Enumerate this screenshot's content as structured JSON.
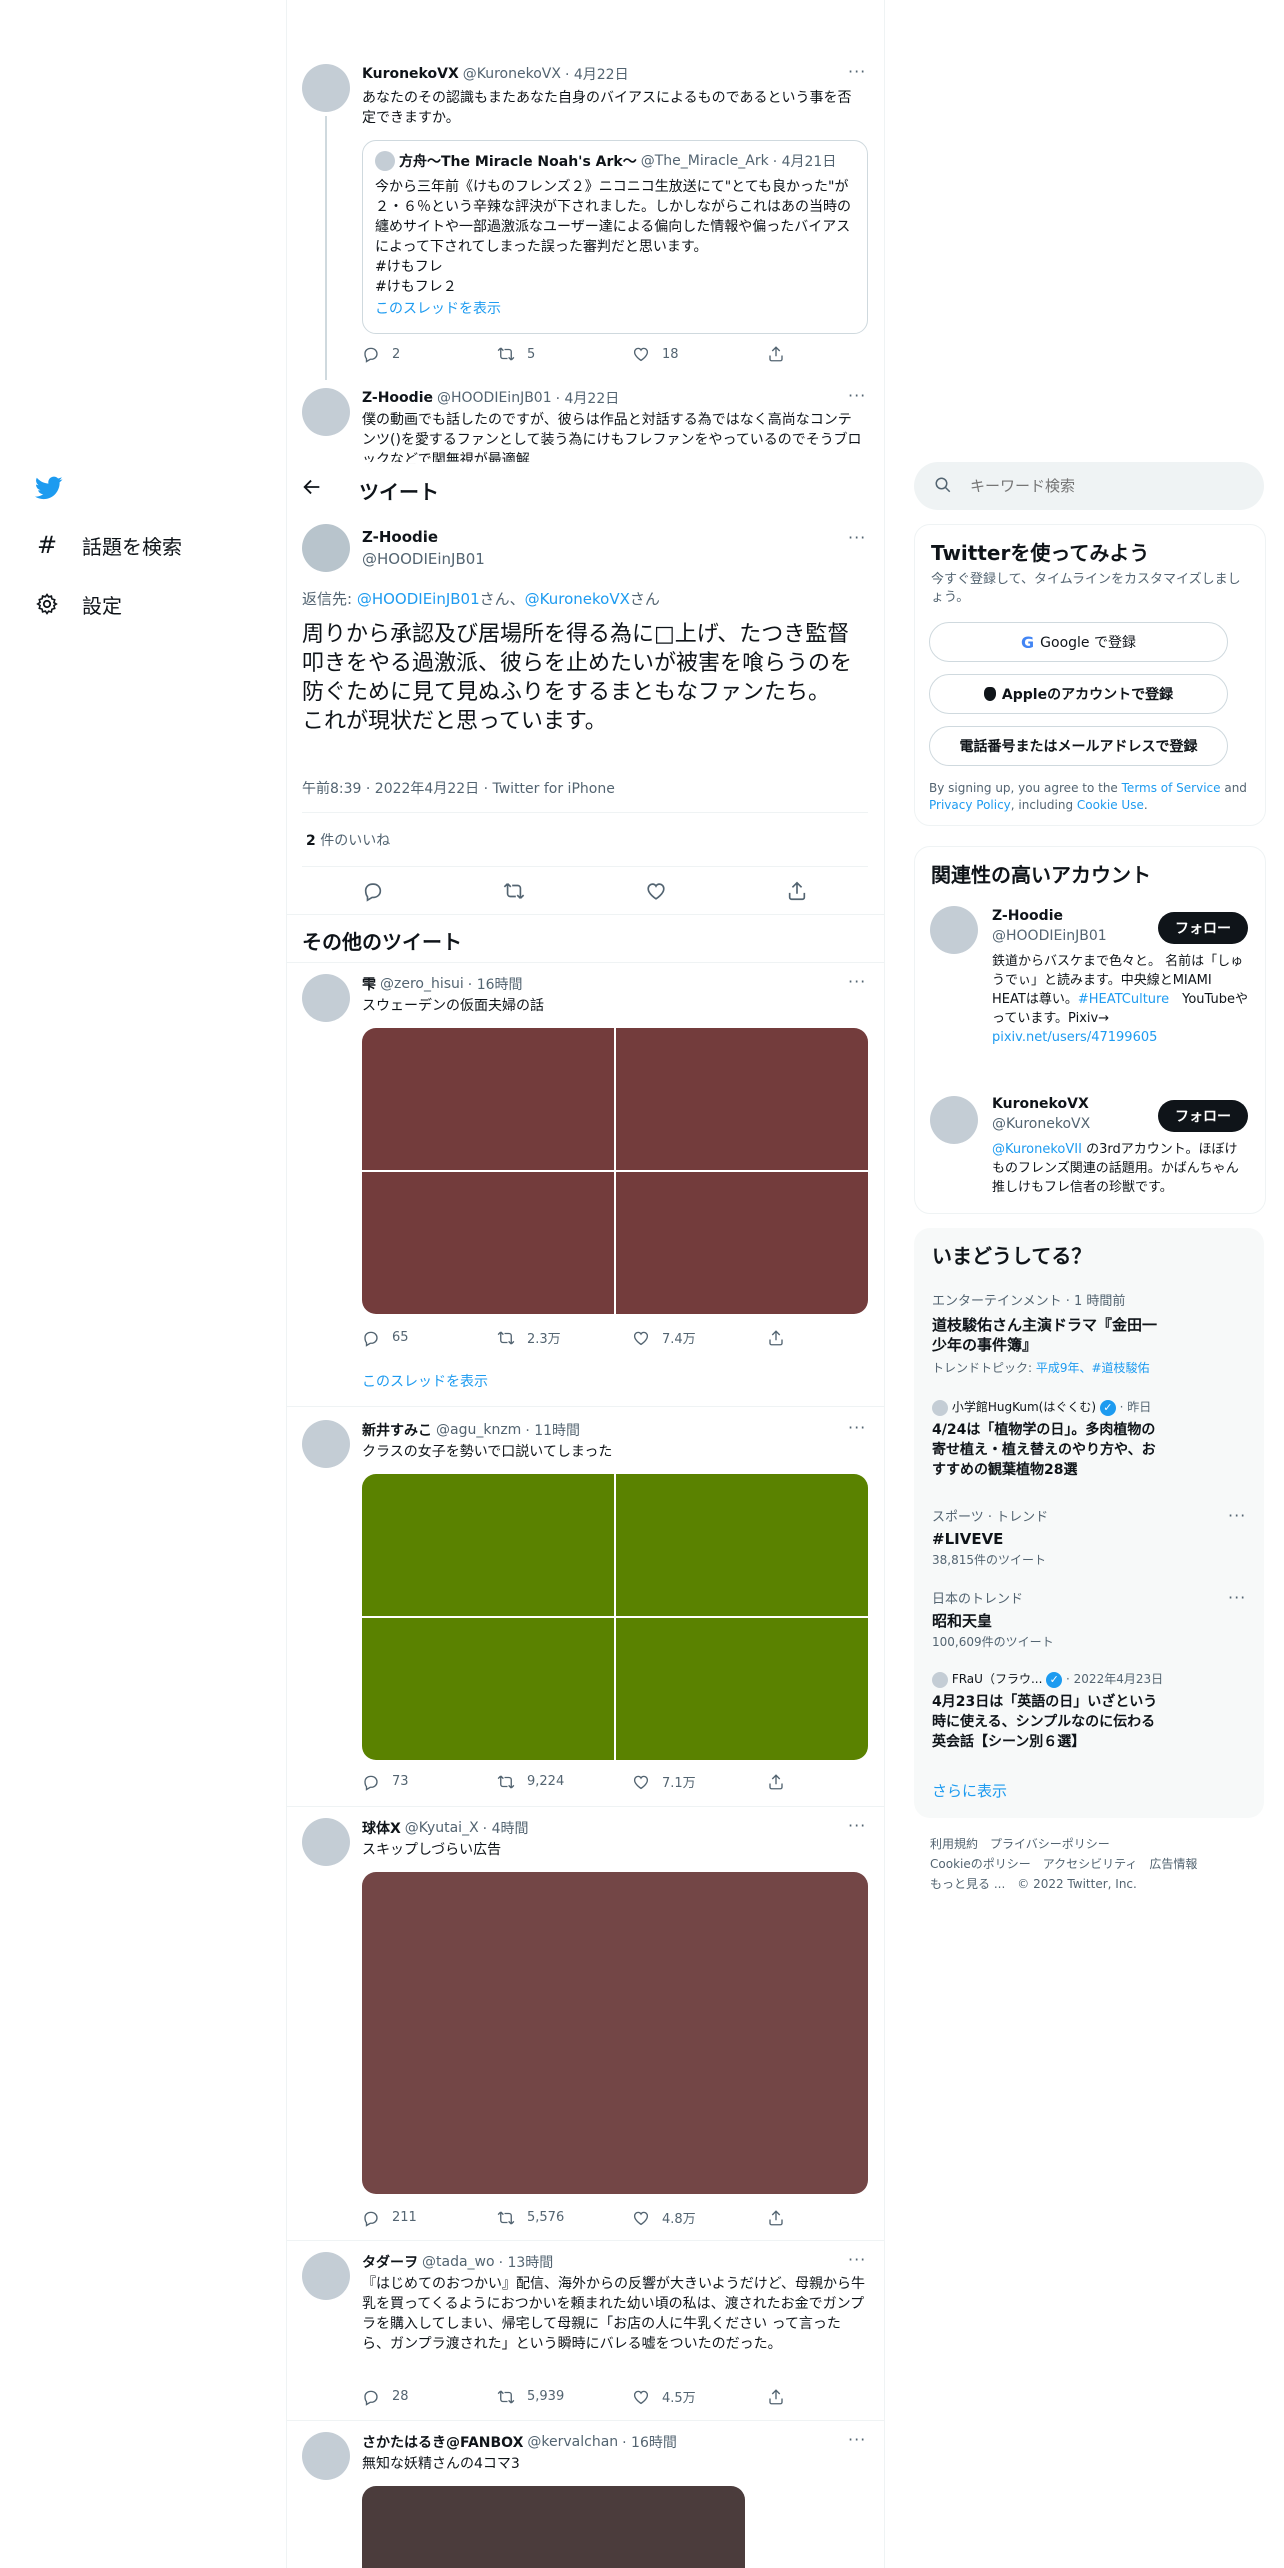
{
  "nav": {
    "explore_label": "話題を検索",
    "settings_label": "設定"
  },
  "header": {
    "title": "ツイート"
  },
  "context_tweets": [
    {
      "name": "KuronekoVX",
      "handle": "@KuronekoVX",
      "time": "· 4月22日",
      "text": "あなたのその認識もまたあなた自身のバイアスによるものであるという事を否定できますか。",
      "quote": {
        "name": "方舟～The Miracle Noah's Ark～",
        "handle": "@The_Miracle_Ark",
        "time": "· 4月21日",
        "lines": [
          "今から三年前《けものフレンズ２》ニコニコ生放送にて\"とても良かった\"が２・６％という辛辣な評決が下されました。しかしながらこれはあの当時の纏めサイトや一部過激派なユーザー達による偏向した情報や偏ったバイアスによって下されてしまった誤った審判だと思います。",
          "#けもフレ",
          "#けもフレ２"
        ],
        "thread_link": "このスレッドを表示"
      },
      "replies": "2",
      "retweets": "5",
      "likes": "18"
    },
    {
      "name": "Z-Hoodie",
      "handle": "@HOODIEinJB01",
      "time": "· 4月22日",
      "text": "僕の動画でも話したのですが、彼らは作品と対話する為ではなく高尚なコンテンツ()を愛するファンとして装う為にけもフレファンをやっているのでそうブロックなどで関無視が最適解"
    }
  ],
  "main_tweet": {
    "name": "Z-Hoodie",
    "handle": "@HOODIEinJB01",
    "reply_prefix": "返信先: ",
    "reply_to_1": "@HOODIEinJB01",
    "reply_san_1": "さん、",
    "reply_to_2": "@KuronekoVX",
    "reply_san_2": "さん",
    "text_1": "周りから承認及び居場所を得る為に□上げ、たつき監督叩きをやる過激派、彼らを止めたいが被害を喰らうのを防ぐために見て見ぬふりをするまともなファンたち。",
    "text_2": "これが現状だと思っています。",
    "meta": "午前8:39 · 2022年4月22日 · Twitter for iPhone",
    "likes_count": "2",
    "likes_label": " 件のいいね"
  },
  "more_tweets": {
    "heading": "その他のツイート",
    "items": [
      {
        "name": "雫",
        "handle": "@zero_hisui",
        "time": "· 16時間",
        "text": "スウェーデンの仮面夫婦の話",
        "image_color": "#733c3c",
        "replies": "65",
        "retweets": "2.3万",
        "likes": "7.4万",
        "thread_link": "このスレッドを表示"
      },
      {
        "name": "新井すみこ",
        "handle": "@agu_knzm",
        "time": "· 11時間",
        "text": "クラスの女子を勢いで口説いてしまった",
        "image_color": "#5a8200",
        "replies": "73",
        "retweets": "9,224",
        "likes": "7.1万"
      },
      {
        "name": "球体X",
        "handle": "@Kyutai_X",
        "time": "· 4時間",
        "text": "スキップしづらい広告",
        "image_color": "#734646",
        "replies": "211",
        "retweets": "5,576",
        "likes": "4.8万"
      },
      {
        "name": "タダーヲ",
        "handle": "@tada_wo",
        "time": "· 13時間",
        "text": "『はじめてのおつかい』配信、海外からの反響が大きいようだけど、母親から牛乳を買ってくるようにおつかいを頼まれた幼い頃の私は、渡されたお金でガンプラを購入してしまい、帰宅して母親に「お店の人に牛乳ください って言ったら、ガンプラ渡された」という瞬時にバレる嘘をついたのだった。",
        "replies": "28",
        "retweets": "5,939",
        "likes": "4.5万"
      },
      {
        "name": "さかたはるき@FANBOX",
        "handle": "@kervalchan",
        "time": "· 16時間",
        "text": "無知な妖精さんの4コマ3",
        "image_color": "#4b3c3c"
      }
    ]
  },
  "search": {
    "placeholder": "キーワード検索"
  },
  "signup": {
    "title": "Twitterを使ってみよう",
    "subtitle": "今すぐ登録して、タイムラインをカスタマイズしましょう。",
    "google": "Google で登録",
    "apple": "Appleのアカウントで登録",
    "phone": "電話番号またはメールアドレスで登録",
    "terms_1": "By signing up, you agree to the ",
    "terms_link": "Terms of Service",
    "terms_2": " and ",
    "privacy_link": "Privacy Policy",
    "terms_3": ", including ",
    "cookie_link": "Cookie Use",
    "terms_4": "."
  },
  "relevant": {
    "title": "関連性の高いアカウント",
    "follow_label": "フォロー",
    "accounts": [
      {
        "name": "Z-Hoodie",
        "handle": "@HOODIEinJB01",
        "bio_1": "鉄道からバスケまで色々と。 名前は「しゅうでぃ」と読みます。中央線とMIAMI HEATは尊い。",
        "bio_link_1": "#HEATCulture",
        "bio_2": "　YouTubeやっています。Pixiv→",
        "bio_link_2": "pixiv.net/users/47199605"
      },
      {
        "name": "KuronekoVX",
        "handle": "@KuronekoVX",
        "bio_link_1": "@KuronekoVII",
        "bio_1": " の3rdアカウント。ほぼけものフレンズ関連の話題用。かばんちゃん推しけもフレ信者の珍獣です。"
      }
    ]
  },
  "trends": {
    "title": "いまどうしてる？",
    "items": [
      {
        "category": "エンターテインメント · 1 時間前",
        "title": "道枝駿佑さん主演ドラマ『金田一少年の事件簿』",
        "topic_prefix": "トレンドトピック: ",
        "topic_links": "平成9年、#道枝駿佑"
      },
      {
        "category": "小学館HugKum(はぐくむ)",
        "category_suffix": " · 昨日",
        "title": "4/24は「植物学の日」。多肉植物の寄せ植え・植え替えのやり方や、おすすめの観葉植物28選"
      },
      {
        "category": "スポーツ · トレンド",
        "title": "#LIVEVE",
        "count": "38,815件のツイート"
      },
      {
        "category": "日本のトレンド",
        "title": "昭和天皇",
        "count": "100,609件のツイート"
      },
      {
        "category": "FRaU（フラウ...",
        "category_suffix": " · 2022年4月23日",
        "title": "4月23日は「英語の日」いざという時に使える、シンプルなのに伝わる英会話【シーン別６選】"
      }
    ],
    "show_more": "さらに表示"
  },
  "footer": {
    "line1": "利用規約　プライバシーポリシー",
    "line2": "Cookieのポリシー　アクセシビリティ　広告情報",
    "line3": "もっと見る ...　© 2022 Twitter, Inc."
  },
  "colors": {
    "accent": "#1d9bf0",
    "text": "#0f1419",
    "muted": "#536471"
  }
}
